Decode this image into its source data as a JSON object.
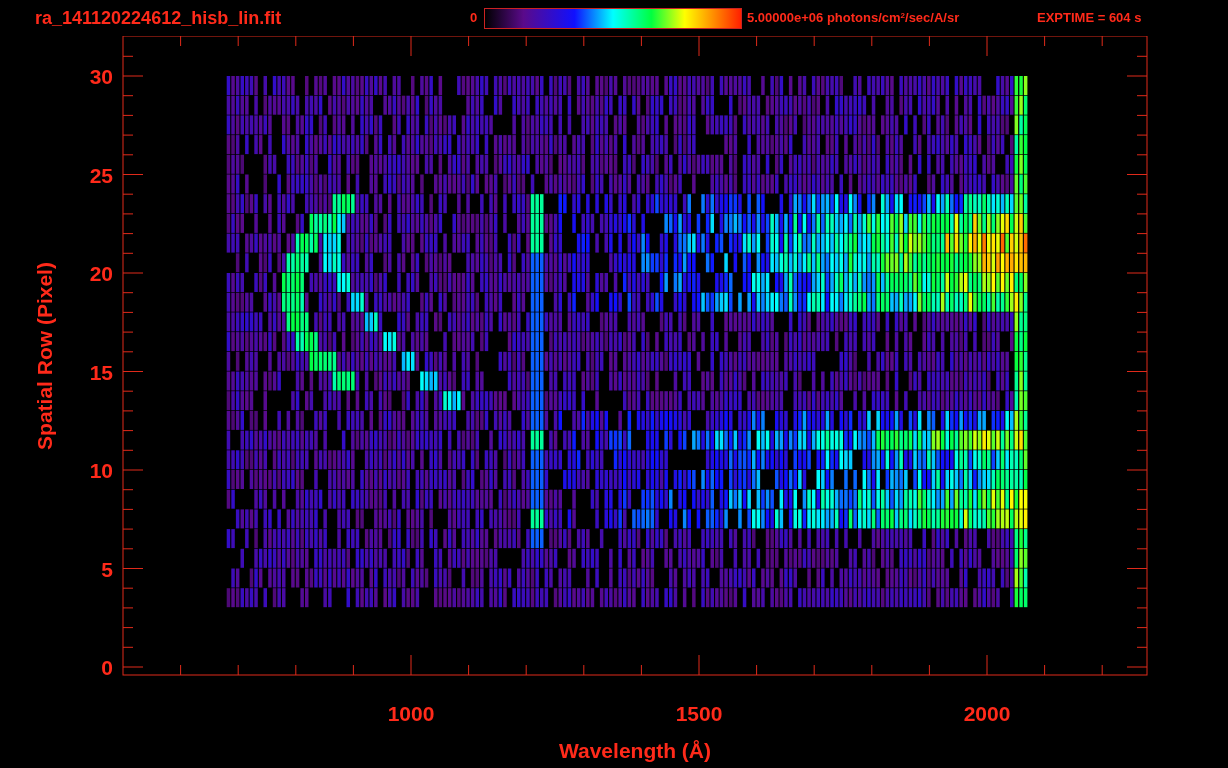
{
  "header": {
    "title": "ra_141120224612_hisb_lin.fit",
    "colorbar": {
      "min_label": "0",
      "max_label": "5.00000e+06 photons/cm$^{2}$/sec/A/sr"
    },
    "exptime": "EXPTIME = 604 s"
  },
  "axes": {
    "xlabel": "Wavelength (Å)",
    "ylabel": "Spatial Row (Pixel)",
    "xticks": [
      "1000",
      "1500",
      "2000"
    ],
    "yticks": [
      "30",
      "25",
      "20",
      "15",
      "10",
      "5",
      "0"
    ]
  }
}
